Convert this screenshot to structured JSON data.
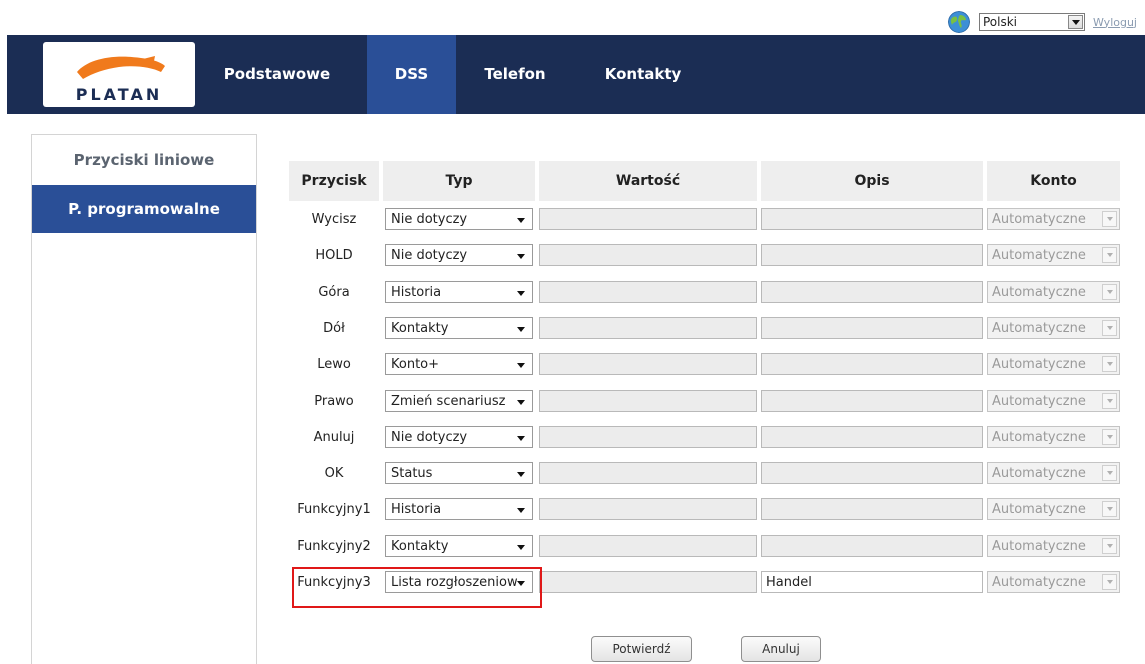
{
  "topbar": {
    "language": "Polski",
    "logout": "Wyloguj"
  },
  "logo": {
    "text": "PLATAN"
  },
  "nav": {
    "items": [
      {
        "label": "Podstawowe"
      },
      {
        "label": "DSS"
      },
      {
        "label": "Telefon"
      },
      {
        "label": "Kontakty"
      }
    ],
    "active": "DSS"
  },
  "sidebar": {
    "items": [
      {
        "label": "Przyciski liniowe"
      },
      {
        "label": "P. programowalne"
      }
    ],
    "active": "P. programowalne"
  },
  "table": {
    "headers": [
      "Przycisk",
      "Typ",
      "Wartość",
      "Opis",
      "Konto"
    ],
    "rows": [
      {
        "przycisk": "Wycisz",
        "typ": "Nie dotyczy",
        "wartosc": "",
        "opis": "",
        "konto": "Automatyczne"
      },
      {
        "przycisk": "HOLD",
        "typ": "Nie dotyczy",
        "wartosc": "",
        "opis": "",
        "konto": "Automatyczne"
      },
      {
        "przycisk": "Góra",
        "typ": "Historia",
        "wartosc": "",
        "opis": "",
        "konto": "Automatyczne"
      },
      {
        "przycisk": "Dół",
        "typ": "Kontakty",
        "wartosc": "",
        "opis": "",
        "konto": "Automatyczne"
      },
      {
        "przycisk": "Lewo",
        "typ": "Konto+",
        "wartosc": "",
        "opis": "",
        "konto": "Automatyczne"
      },
      {
        "przycisk": "Prawo",
        "typ": "Zmień scenariusz",
        "wartosc": "",
        "opis": "",
        "konto": "Automatyczne"
      },
      {
        "przycisk": "Anuluj",
        "typ": "Nie dotyczy",
        "wartosc": "",
        "opis": "",
        "konto": "Automatyczne"
      },
      {
        "przycisk": "OK",
        "typ": "Status",
        "wartosc": "",
        "opis": "",
        "konto": "Automatyczne"
      },
      {
        "przycisk": "Funkcyjny1",
        "typ": "Historia",
        "wartosc": "",
        "opis": "",
        "konto": "Automatyczne"
      },
      {
        "przycisk": "Funkcyjny2",
        "typ": "Kontakty",
        "wartosc": "",
        "opis": "",
        "konto": "Automatyczne"
      },
      {
        "przycisk": "Funkcyjny3",
        "typ": "Lista rozgłoszeniow",
        "wartosc": "",
        "opis": "Handel",
        "konto": "Automatyczne"
      }
    ]
  },
  "buttons": {
    "confirm": "Potwierdź",
    "cancel": "Anuluj"
  },
  "colors": {
    "header_bg": "#1b2d54",
    "active_tab": "#2a4f97",
    "highlight": "#e01818",
    "logo_orange": "#f07a1c"
  }
}
